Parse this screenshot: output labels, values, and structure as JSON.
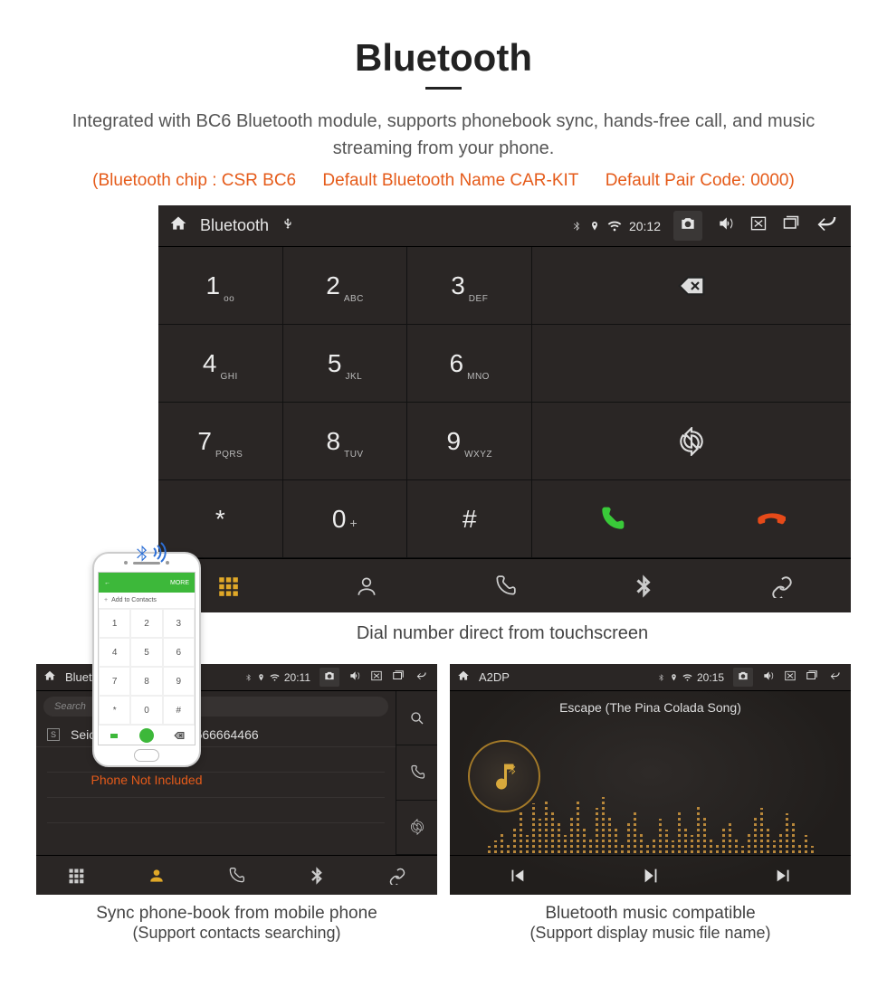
{
  "headline": {
    "title": "Bluetooth"
  },
  "description": "Integrated with BC6 Bluetooth module, supports phonebook sync, hands-free call, and music streaming from your phone.",
  "spec_line": {
    "chip": "(Bluetooth chip : CSR BC6",
    "name": "Default Bluetooth Name CAR-KIT",
    "code": "Default Pair Code: 0000)"
  },
  "main_screen": {
    "status": {
      "title": "Bluetooth",
      "time": "20:12"
    },
    "keys": [
      [
        {
          "digit": "1",
          "letters": "oo"
        },
        {
          "digit": "2",
          "letters": "ABC"
        },
        {
          "digit": "3",
          "letters": "DEF"
        }
      ],
      [
        {
          "digit": "4",
          "letters": "GHI"
        },
        {
          "digit": "5",
          "letters": "JKL"
        },
        {
          "digit": "6",
          "letters": "MNO"
        }
      ],
      [
        {
          "digit": "7",
          "letters": "PQRS"
        },
        {
          "digit": "8",
          "letters": "TUV"
        },
        {
          "digit": "9",
          "letters": "WXYZ"
        }
      ],
      [
        {
          "digit": "*",
          "letters": ""
        },
        {
          "digit": "0",
          "letters": "+",
          "plus": true
        },
        {
          "digit": "#",
          "letters": ""
        }
      ]
    ],
    "caption": "Dial number direct from touchscreen"
  },
  "phone_mock": {
    "label": "Phone Not Included",
    "green_left": "←",
    "green_right": "MORE",
    "add_contacts": "Add to Contacts",
    "keys": [
      "1",
      "2",
      "3",
      "4",
      "5",
      "6",
      "7",
      "8",
      "9",
      "*",
      "0",
      "#"
    ]
  },
  "phonebook": {
    "status": {
      "title": "Bluetooth",
      "time": "20:11"
    },
    "search_placeholder": "Search",
    "contact": {
      "initial": "S",
      "name": "Seicane",
      "number": "13566664466"
    },
    "caption_line1": "Sync phone-book from mobile phone",
    "caption_line2": "(Support contacts searching)"
  },
  "a2dp": {
    "status": {
      "title": "A2DP",
      "time": "20:15"
    },
    "song": "Escape (The Pina Colada Song)",
    "caption_line1": "Bluetooth music compatible",
    "caption_line2": "(Support display music file name)"
  }
}
